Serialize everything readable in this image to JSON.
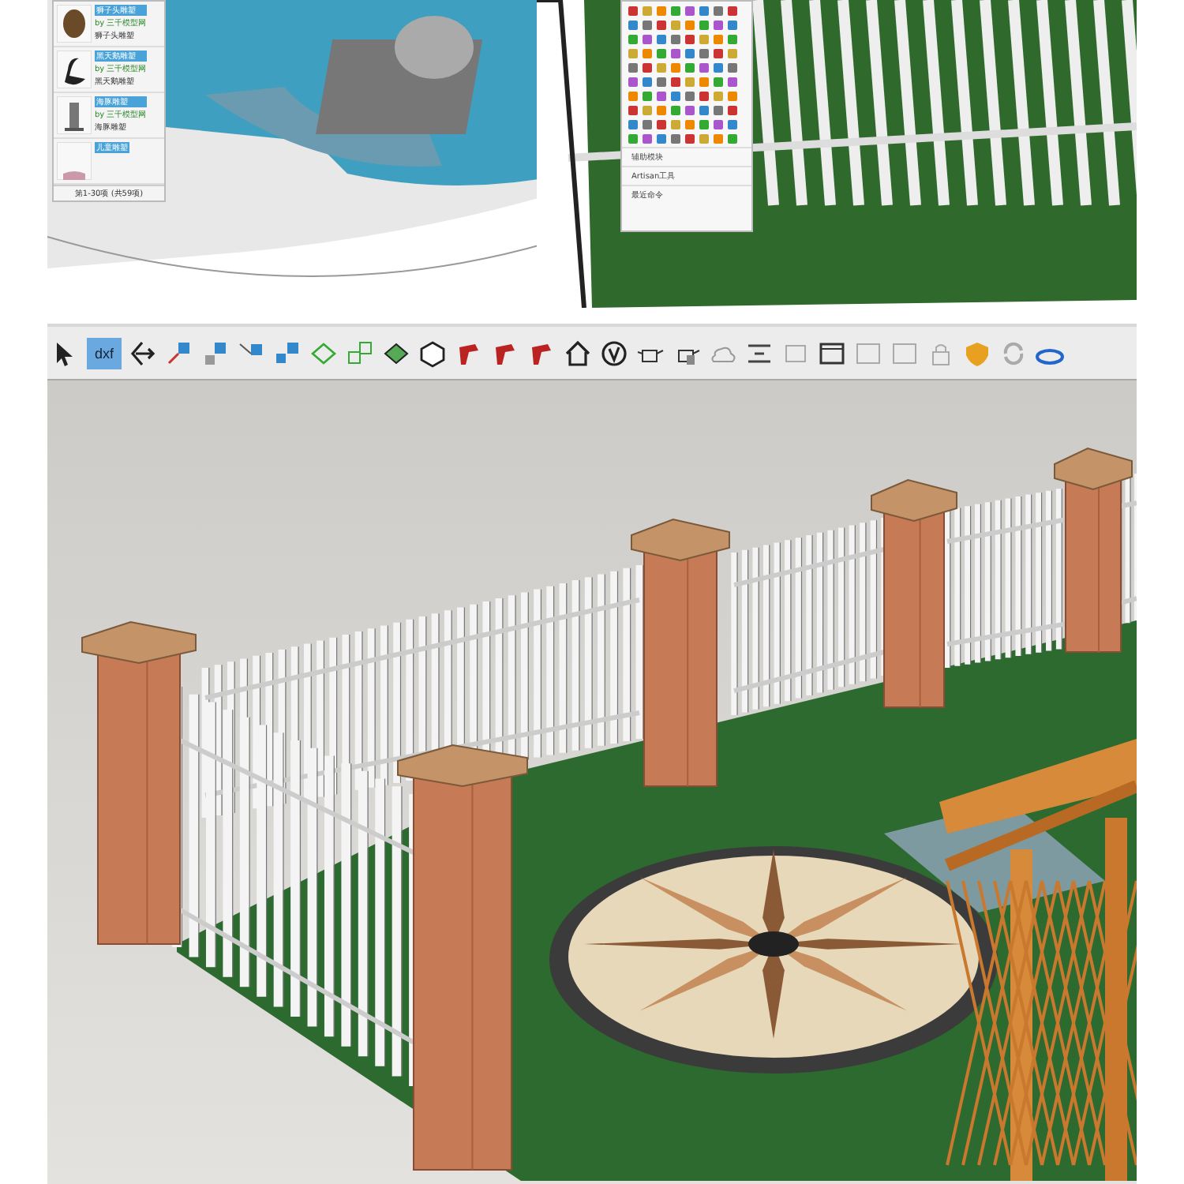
{
  "model_panel": {
    "items": [
      {
        "title": "狮子头雕塑",
        "author": "by 三千模型网",
        "name": "狮子头雕塑",
        "kind": "lion"
      },
      {
        "title": "黑天鹅雕塑",
        "author": "by 三千模型网",
        "name": "黑天鹅雕塑",
        "kind": "swan"
      },
      {
        "title": "海豚雕塑",
        "author": "by 三千模型网",
        "name": "海豚雕塑",
        "kind": "statue"
      },
      {
        "title": "儿童雕塑",
        "kind": "cropped"
      }
    ],
    "pager": "第1-30项 (共59项)"
  },
  "tool_palette": {
    "menu": [
      "辅助模块",
      "Artisan工具",
      "最近命令"
    ]
  },
  "toolbar": {
    "dxf_label": "dxf"
  }
}
